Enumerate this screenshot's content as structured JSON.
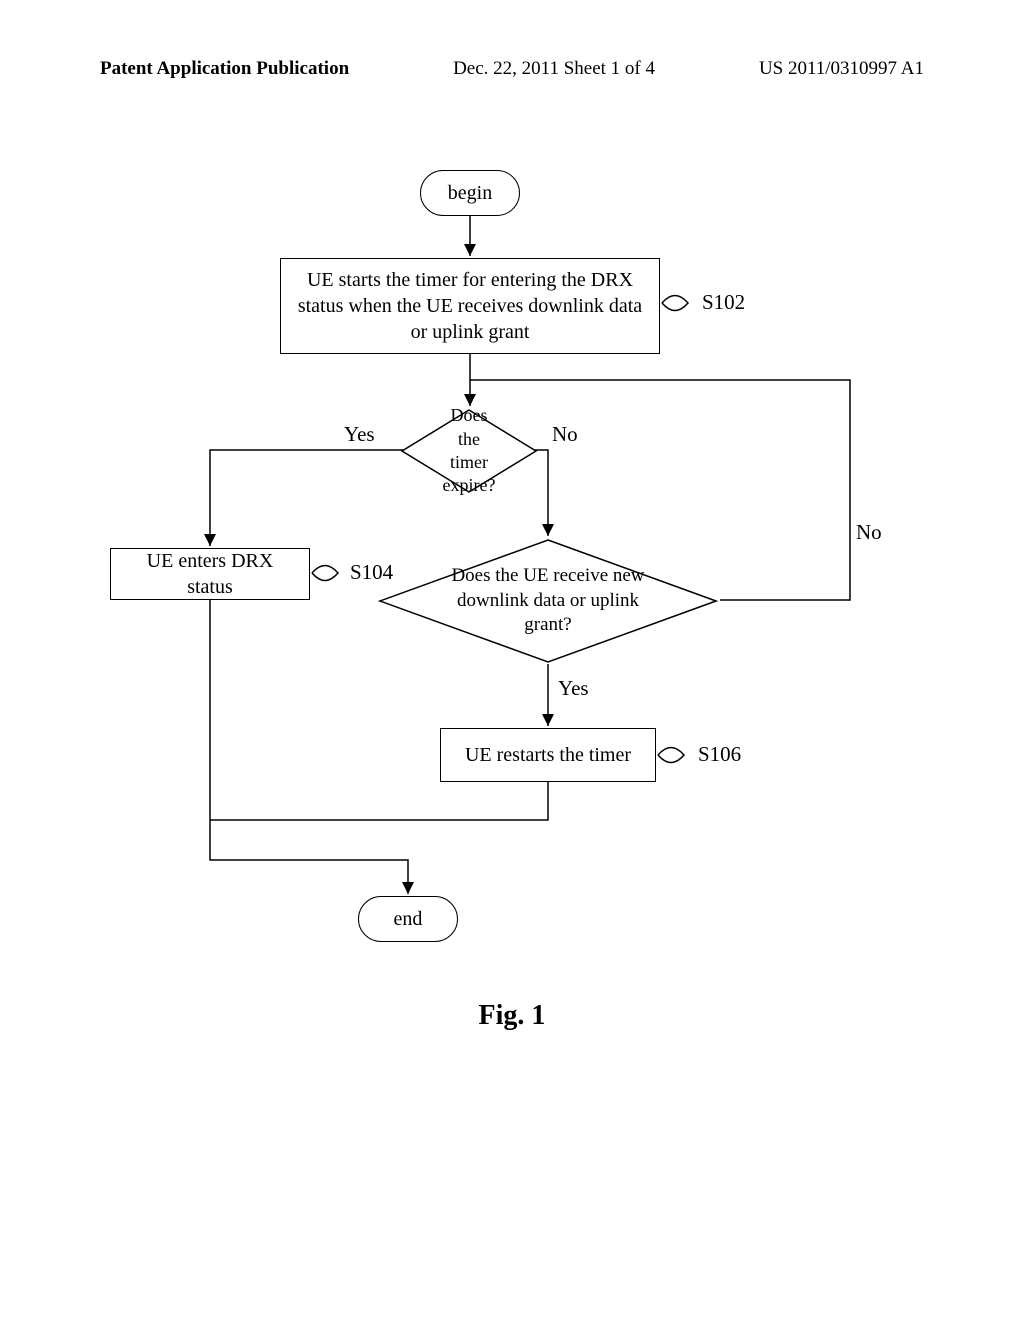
{
  "header": {
    "left": "Patent Application Publication",
    "center": "Dec. 22, 2011  Sheet 1 of 4",
    "right": "US 2011/0310997 A1"
  },
  "chart_data": {
    "type": "flowchart",
    "title": "Fig. 1",
    "nodes": [
      {
        "id": "begin",
        "type": "terminator",
        "text": "begin"
      },
      {
        "id": "s102",
        "type": "process",
        "label": "S102",
        "text": "UE starts the timer for entering the DRX status when the UE receives downlink data or uplink grant"
      },
      {
        "id": "d1",
        "type": "decision",
        "text": "Does the timer expire?"
      },
      {
        "id": "s104",
        "type": "process",
        "label": "S104",
        "text": "UE enters DRX status"
      },
      {
        "id": "d2",
        "type": "decision",
        "text": "Does the UE receive new downlink data or uplink grant?"
      },
      {
        "id": "s106",
        "type": "process",
        "label": "S106",
        "text": "UE restarts the timer"
      },
      {
        "id": "end",
        "type": "terminator",
        "text": "end"
      }
    ],
    "edges": [
      {
        "from": "begin",
        "to": "s102"
      },
      {
        "from": "s102",
        "to": "d1"
      },
      {
        "from": "d1",
        "to": "s104",
        "label": "Yes"
      },
      {
        "from": "d1",
        "to": "d2",
        "label": "No"
      },
      {
        "from": "d2",
        "to": "d1",
        "label": "No"
      },
      {
        "from": "d2",
        "to": "s106",
        "label": "Yes"
      },
      {
        "from": "s104",
        "to": "end"
      },
      {
        "from": "s106",
        "to": "end"
      }
    ]
  },
  "edge_labels": {
    "d1_yes": "Yes",
    "d1_no": "No",
    "d2_no": "No",
    "d2_yes": "Yes"
  }
}
